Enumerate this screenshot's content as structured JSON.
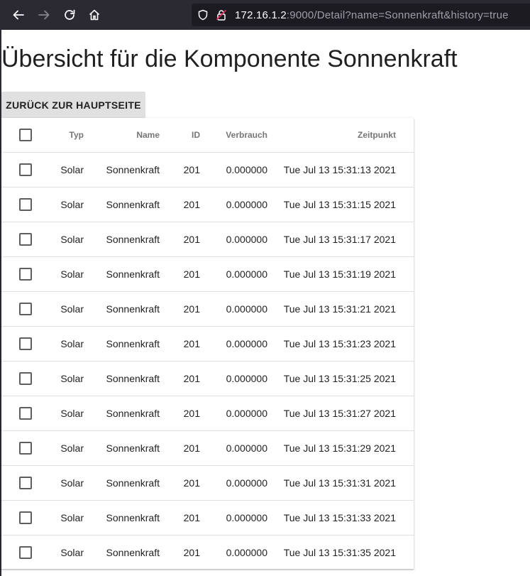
{
  "browser": {
    "url_host": "172.16.1.2",
    "url_rest": ":9000/Detail?name=Sonnenkraft&history=true"
  },
  "page": {
    "title": "Übersicht für die Komponente Sonnenkraft",
    "back_button_label": "ZURÜCK ZUR HAUPTSEITE"
  },
  "table": {
    "headers": {
      "typ": "Typ",
      "name": "Name",
      "id": "ID",
      "verbrauch": "Verbrauch",
      "zeitpunkt": "Zeitpunkt"
    },
    "rows": [
      {
        "typ": "Solar",
        "name": "Sonnenkraft",
        "id": "201",
        "verbrauch": "0.000000",
        "zeitpunkt": "Tue Jul 13 15:31:13 2021",
        "checked": false
      },
      {
        "typ": "Solar",
        "name": "Sonnenkraft",
        "id": "201",
        "verbrauch": "0.000000",
        "zeitpunkt": "Tue Jul 13 15:31:15 2021",
        "checked": false
      },
      {
        "typ": "Solar",
        "name": "Sonnenkraft",
        "id": "201",
        "verbrauch": "0.000000",
        "zeitpunkt": "Tue Jul 13 15:31:17 2021",
        "checked": false
      },
      {
        "typ": "Solar",
        "name": "Sonnenkraft",
        "id": "201",
        "verbrauch": "0.000000",
        "zeitpunkt": "Tue Jul 13 15:31:19 2021",
        "checked": false
      },
      {
        "typ": "Solar",
        "name": "Sonnenkraft",
        "id": "201",
        "verbrauch": "0.000000",
        "zeitpunkt": "Tue Jul 13 15:31:21 2021",
        "checked": false
      },
      {
        "typ": "Solar",
        "name": "Sonnenkraft",
        "id": "201",
        "verbrauch": "0.000000",
        "zeitpunkt": "Tue Jul 13 15:31:23 2021",
        "checked": false
      },
      {
        "typ": "Solar",
        "name": "Sonnenkraft",
        "id": "201",
        "verbrauch": "0.000000",
        "zeitpunkt": "Tue Jul 13 15:31:25 2021",
        "checked": false
      },
      {
        "typ": "Solar",
        "name": "Sonnenkraft",
        "id": "201",
        "verbrauch": "0.000000",
        "zeitpunkt": "Tue Jul 13 15:31:27 2021",
        "checked": false
      },
      {
        "typ": "Solar",
        "name": "Sonnenkraft",
        "id": "201",
        "verbrauch": "0.000000",
        "zeitpunkt": "Tue Jul 13 15:31:29 2021",
        "checked": false
      },
      {
        "typ": "Solar",
        "name": "Sonnenkraft",
        "id": "201",
        "verbrauch": "0.000000",
        "zeitpunkt": "Tue Jul 13 15:31:31 2021",
        "checked": false
      },
      {
        "typ": "Solar",
        "name": "Sonnenkraft",
        "id": "201",
        "verbrauch": "0.000000",
        "zeitpunkt": "Tue Jul 13 15:31:33 2021",
        "checked": false
      },
      {
        "typ": "Solar",
        "name": "Sonnenkraft",
        "id": "201",
        "verbrauch": "0.000000",
        "zeitpunkt": "Tue Jul 13 15:31:35 2021",
        "checked": false
      }
    ]
  },
  "icons": {
    "back": "arrow-left-icon",
    "forward": "arrow-right-icon",
    "reload": "reload-icon",
    "home": "home-icon",
    "shield": "shield-icon",
    "insecure_lock": "insecure-lock-icon",
    "checkbox": "checkbox-icon"
  }
}
